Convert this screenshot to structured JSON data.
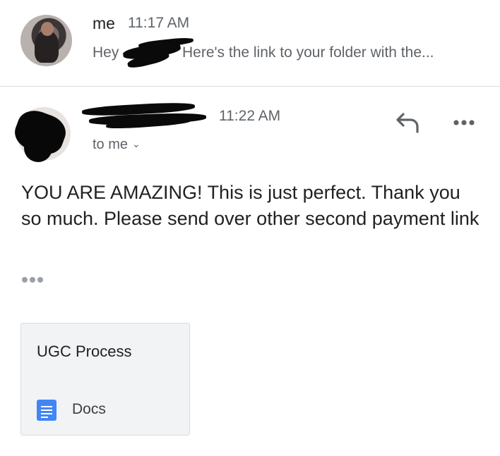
{
  "thread": {
    "messages": [
      {
        "sender": "me",
        "time": "11:17 AM",
        "snippet_prefix": "Hey",
        "snippet_suffix": "Here's the link to your folder with the..."
      },
      {
        "time": "11:22 AM",
        "recipient_label": "to me",
        "body": "YOU ARE AMAZING! This is just perfect. Thank you so much. Please send over other second payment link",
        "attachment": {
          "title": "UGC Process",
          "type": "Docs",
          "icon": "google-docs-icon",
          "icon_color": "#4285f4"
        }
      }
    ]
  },
  "icons": {
    "reply": "reply-arrow-icon",
    "more": "more-horizontal-icon",
    "chevron": "chevron-down-icon"
  },
  "colors": {
    "text_primary": "#202124",
    "text_secondary": "#5f6368",
    "divider": "#dadce0",
    "card_background": "#f1f3f4"
  }
}
